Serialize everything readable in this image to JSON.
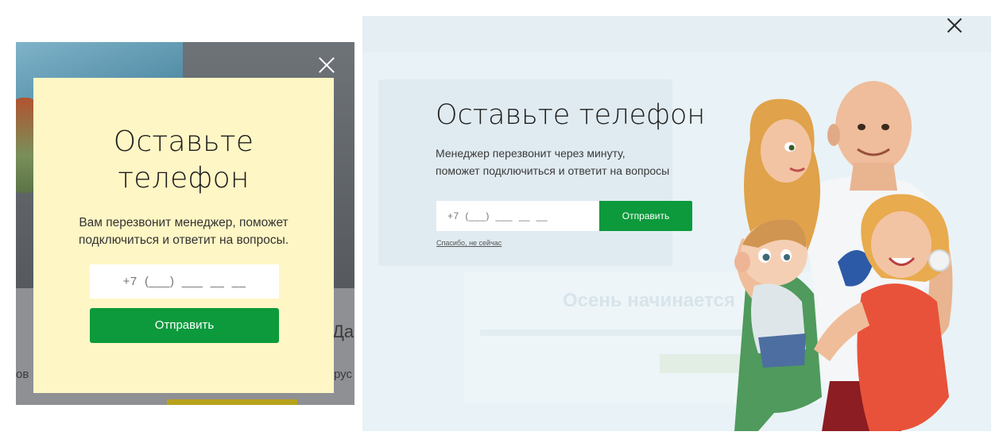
{
  "left_popup": {
    "title_line1": "Оставьте",
    "title_line2": "телефон",
    "subtitle_line1": "Вам перезвонит менеджер, поможет",
    "subtitle_line2": "подключиться и ответит на вопросы.",
    "phone_placeholder": "+7  (___)  ___  __  __",
    "submit_label": "Отправить",
    "bg_fragment_big": "Да",
    "bg_fragment_left": "ов",
    "bg_fragment_right": "рус"
  },
  "right_popup": {
    "title": "Оставьте телефон",
    "subtitle_line1": "Менеджер перезвонит через минуту,",
    "subtitle_line2": "поможет подключиться и ответит на вопросы",
    "phone_placeholder": "+7  (___)  ___  __  __",
    "submit_label": "Отправить",
    "dismiss_label": "Спасибо, не сейчас",
    "bg_ghost_title": "Осень начинается"
  },
  "colors": {
    "accent_green": "#0c9a3c",
    "yellow_popup_bg": "#fff6c5",
    "blue_popup_bg": "#e9f2f6"
  },
  "icons": {
    "close": "close-icon",
    "illustration": "family-illustration"
  }
}
